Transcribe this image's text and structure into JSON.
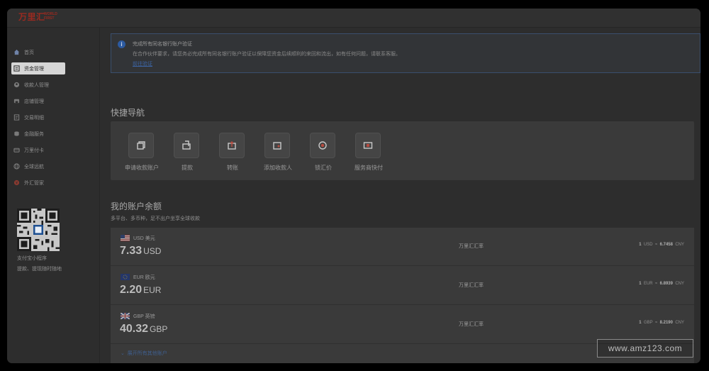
{
  "brand": {
    "name_cn": "万里汇",
    "name_en_line1": "WORLD",
    "name_en_line2": "FIRST",
    "color": "#9a2a20"
  },
  "sidebar": {
    "items": [
      {
        "label": "首页",
        "icon": "home-icon",
        "active": false
      },
      {
        "label": "资金管理",
        "icon": "wallet-icon",
        "active": true
      },
      {
        "label": "收款人管理",
        "icon": "user-icon",
        "active": false
      },
      {
        "label": "店铺管理",
        "icon": "shop-icon",
        "active": false
      },
      {
        "label": "交易明细",
        "icon": "ledger-icon",
        "active": false
      },
      {
        "label": "金融服务",
        "icon": "finance-icon",
        "active": false
      },
      {
        "label": "万里付卡",
        "icon": "card-icon",
        "active": false
      },
      {
        "label": "全球远航",
        "icon": "globe-icon",
        "active": false
      },
      {
        "label": "外汇管家",
        "icon": "fx-icon",
        "active": false
      }
    ],
    "qr_caption_1": "支付宝小程序",
    "qr_caption_2": "提款、提现随时随地"
  },
  "alert": {
    "title": "完成所有同名银行账户验证",
    "text": "在合作伙伴要求，请您务必完成所有同名银行账户验证以保障您资金后续顺利的来回和流出，如有任何问题，请联系客服。",
    "link": "前往验证",
    "accent": "#2c5aa0"
  },
  "quick_nav": {
    "title": "快捷导航",
    "items": [
      {
        "label": "申请收款账户",
        "icon": "receive-account-icon"
      },
      {
        "label": "提款",
        "icon": "withdraw-icon"
      },
      {
        "label": "转账",
        "icon": "transfer-icon"
      },
      {
        "label": "添加收款人",
        "icon": "add-payee-icon"
      },
      {
        "label": "锁汇价",
        "icon": "lock-rate-icon"
      },
      {
        "label": "服务商快付",
        "icon": "fast-pay-icon"
      }
    ]
  },
  "balances": {
    "title": "我的账户余额",
    "subtitle": "多平台、多币种，足不出户坐享全球收款",
    "rows": [
      {
        "flag": "us-flag-icon",
        "currency_label": "USD 美元",
        "amount": "7.33",
        "currency": "USD",
        "rate_label": "万里汇汇率",
        "rate_left": "1",
        "rate_left_ccy": "USD",
        "rate_sep": "≈",
        "rate_value": "6.7458",
        "rate_right_ccy": "CNY"
      },
      {
        "flag": "eu-flag-icon",
        "currency_label": "EUR 欧元",
        "amount": "2.20",
        "currency": "EUR",
        "rate_label": "万里汇汇率",
        "rate_left": "1",
        "rate_left_ccy": "EUR",
        "rate_sep": "≈",
        "rate_value": "6.8939",
        "rate_right_ccy": "CNY"
      },
      {
        "flag": "gb-flag-icon",
        "currency_label": "GBP 英镑",
        "amount": "40.32",
        "currency": "GBP",
        "rate_label": "万里汇汇率",
        "rate_left": "1",
        "rate_left_ccy": "GBP",
        "rate_sep": "≈",
        "rate_value": "8.2190",
        "rate_right_ccy": "CNY"
      }
    ],
    "expand_label": "展开所有其他账户"
  },
  "watermark": "www.amz123.com"
}
